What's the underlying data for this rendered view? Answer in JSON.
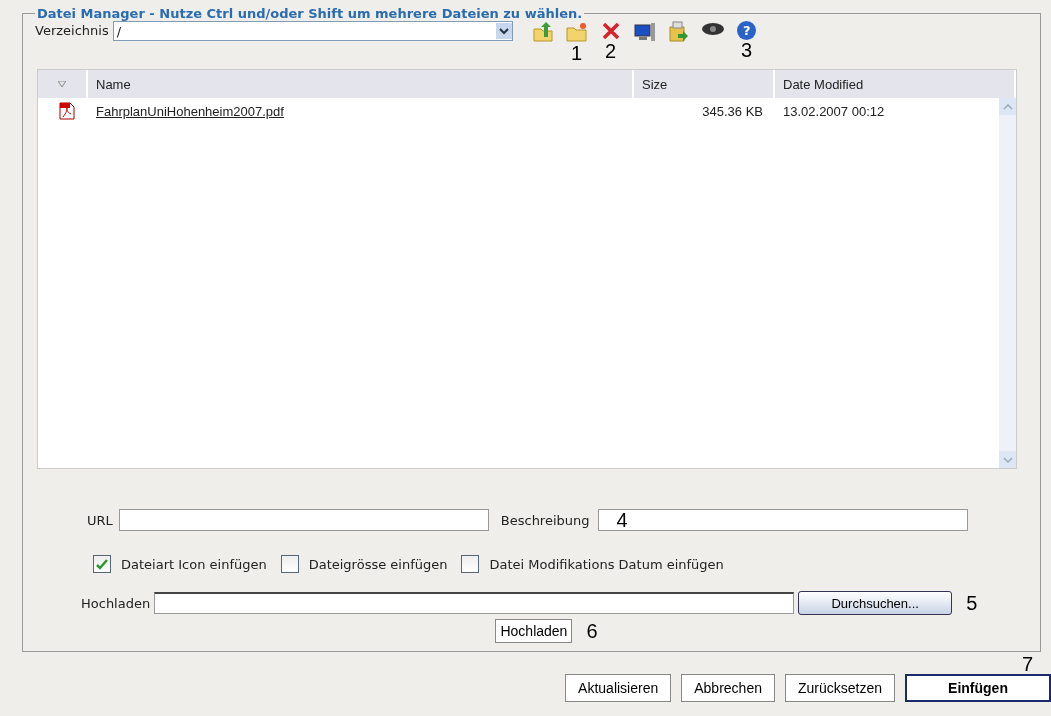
{
  "panel": {
    "legend": "Datei Manager - Nutze Ctrl und/oder Shift um mehrere Dateien zu wählen."
  },
  "directory": {
    "label": "Verzeichnis",
    "value": "/"
  },
  "toolbar": [
    {
      "kind": "up"
    },
    {
      "kind": "newfolder",
      "annotation": "1"
    },
    {
      "kind": "delete",
      "annotation": "2"
    },
    {
      "kind": "monitor"
    },
    {
      "kind": "save"
    },
    {
      "kind": "view"
    },
    {
      "kind": "help",
      "glyph": "?",
      "annotation": "3"
    }
  ],
  "table": {
    "columns": [
      "Name",
      "Size",
      "Date Modified"
    ],
    "rows": [
      {
        "name": "FahrplanUniHohenheim2007.pdf",
        "size": "345.36 KB",
        "date": "13.02.2007 00:12"
      }
    ]
  },
  "url": {
    "label": "URL"
  },
  "description": {
    "label": "Beschreibung",
    "annotation": "4"
  },
  "options": [
    {
      "label": "Dateiart Icon einfügen",
      "checked": true
    },
    {
      "label": "Dateigrösse einfügen",
      "checked": false
    },
    {
      "label": "Datei Modifikations Datum einfügen",
      "checked": false
    }
  ],
  "upload": {
    "label": "Hochladen",
    "browse": "Durchsuchen...",
    "browse_annotation": "5",
    "button": "Hochladen",
    "button_annotation": "6"
  },
  "buttons": [
    {
      "label": "Aktualisieren",
      "primary": false
    },
    {
      "label": "Abbrechen",
      "primary": false
    },
    {
      "label": "Zurücksetzen",
      "primary": false
    },
    {
      "label": "Einfügen",
      "primary": true
    }
  ],
  "buttons_annotation": "7"
}
